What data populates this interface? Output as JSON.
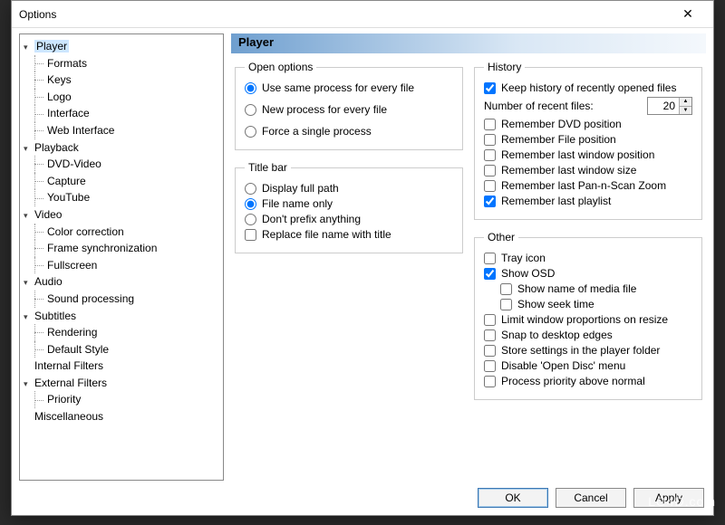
{
  "window": {
    "title": "Options",
    "close_glyph": "✕"
  },
  "panel_title": "Player",
  "tree": [
    {
      "label": "Player",
      "type": "parent",
      "selected": true
    },
    {
      "label": "Formats",
      "type": "child"
    },
    {
      "label": "Keys",
      "type": "child"
    },
    {
      "label": "Logo",
      "type": "child"
    },
    {
      "label": "Interface",
      "type": "child"
    },
    {
      "label": "Web Interface",
      "type": "child"
    },
    {
      "label": "Playback",
      "type": "parent"
    },
    {
      "label": "DVD-Video",
      "type": "child"
    },
    {
      "label": "Capture",
      "type": "child"
    },
    {
      "label": "YouTube",
      "type": "child"
    },
    {
      "label": "Video",
      "type": "parent"
    },
    {
      "label": "Color correction",
      "type": "child"
    },
    {
      "label": "Frame synchronization",
      "type": "child"
    },
    {
      "label": "Fullscreen",
      "type": "child"
    },
    {
      "label": "Audio",
      "type": "parent"
    },
    {
      "label": "Sound processing",
      "type": "child"
    },
    {
      "label": "Subtitles",
      "type": "parent"
    },
    {
      "label": "Rendering",
      "type": "child"
    },
    {
      "label": "Default Style",
      "type": "child"
    },
    {
      "label": "Internal Filters",
      "type": "leaf"
    },
    {
      "label": "External Filters",
      "type": "parent"
    },
    {
      "label": "Priority",
      "type": "child"
    },
    {
      "label": "Miscellaneous",
      "type": "leaf"
    }
  ],
  "open_options": {
    "legend": "Open options",
    "same_process": "Use same process for every file",
    "new_process": "New process for every file",
    "force_single": "Force a single process",
    "selected": "same_process"
  },
  "title_bar": {
    "legend": "Title bar",
    "full_path": "Display full path",
    "file_name": "File name only",
    "no_prefix": "Don't prefix anything",
    "replace_title": "Replace file name with title",
    "selected": "file_name",
    "replace_checked": false
  },
  "history": {
    "legend": "History",
    "keep_history": "Keep history of recently opened files",
    "keep_history_checked": true,
    "recent_label": "Number of recent files:",
    "recent_value": "20",
    "remember_dvd": "Remember DVD position",
    "remember_file": "Remember File position",
    "remember_winpos": "Remember last window position",
    "remember_winsize": "Remember last window size",
    "remember_pns": "Remember last Pan-n-Scan Zoom",
    "remember_playlist": "Remember last playlist",
    "dvd_checked": false,
    "file_checked": false,
    "winpos_checked": false,
    "winsize_checked": false,
    "pns_checked": false,
    "playlist_checked": true
  },
  "other": {
    "legend": "Other",
    "tray_icon": "Tray icon",
    "show_osd": "Show OSD",
    "show_media_name": "Show name of media file",
    "show_seek": "Show seek time",
    "limit_prop": "Limit window proportions on resize",
    "snap_edges": "Snap to desktop edges",
    "store_folder": "Store settings in the player folder",
    "disable_opendisc": "Disable 'Open Disc' menu",
    "priority_above": "Process priority above normal",
    "tray_checked": false,
    "osd_checked": true,
    "media_name_checked": false,
    "seek_checked": false,
    "limit_checked": false,
    "snap_checked": false,
    "store_checked": false,
    "opendisc_checked": false,
    "priority_checked": false
  },
  "buttons": {
    "ok": "OK",
    "cancel": "Cancel",
    "apply": "Apply"
  },
  "watermark": "LO4D.com"
}
